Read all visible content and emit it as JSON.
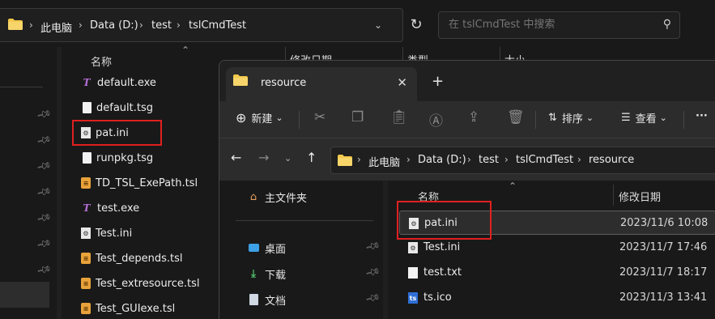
{
  "colors": {
    "highlight": "#e02020",
    "folder": "#f2c94c",
    "ts_icon": "#b66fd6",
    "tsl_icon": "#e8a23a"
  },
  "bg_window": {
    "breadcrumb": [
      "此电脑",
      "Data (D:)",
      "test",
      "tslCmdTest"
    ],
    "search_placeholder": "在 tslCmdTest 中搜索",
    "headers": {
      "name": "名称",
      "date": "修改日期",
      "type": "类型",
      "size": "大小"
    },
    "files": [
      {
        "name": "default.exe",
        "icon": "ts-icon"
      },
      {
        "name": "default.tsg",
        "icon": "document-icon"
      },
      {
        "name": "pat.ini",
        "icon": "ini-file-icon"
      },
      {
        "name": "runpkg.tsg",
        "icon": "document-icon"
      },
      {
        "name": "TD_TSL_ExePath.tsl",
        "icon": "tsl-file-icon"
      },
      {
        "name": "test.exe",
        "icon": "ts-icon"
      },
      {
        "name": "Test.ini",
        "icon": "ini-file-icon"
      },
      {
        "name": "Test_depends.tsl",
        "icon": "tsl-file-icon"
      },
      {
        "name": "Test_extresource.tsl",
        "icon": "tsl-file-icon"
      },
      {
        "name": "Test_GUIexe.tsl",
        "icon": "tsl-file-icon"
      }
    ]
  },
  "fg_window": {
    "tab_title": "resource",
    "toolbar": {
      "new_label": "新建",
      "sort_label": "排序",
      "view_label": "查看",
      "more_label": "···"
    },
    "breadcrumb": [
      "此电脑",
      "Data (D:)",
      "test",
      "tslCmdTest",
      "resource"
    ],
    "nav": {
      "home": "主文件夹",
      "desktop": "桌面",
      "downloads": "下载",
      "documents": "文档"
    },
    "headers": {
      "name": "名称",
      "date": "修改日期"
    },
    "files": [
      {
        "name": "pat.ini",
        "date": "2023/11/6 10:08",
        "icon": "ini-file-icon"
      },
      {
        "name": "Test.ini",
        "date": "2023/11/7 17:46",
        "icon": "ini-file-icon"
      },
      {
        "name": "test.txt",
        "date": "2023/11/7 18:17",
        "icon": "text-file-icon"
      },
      {
        "name": "ts.ico",
        "date": "2023/11/3 13:41",
        "icon": "icon-file-icon"
      }
    ]
  }
}
